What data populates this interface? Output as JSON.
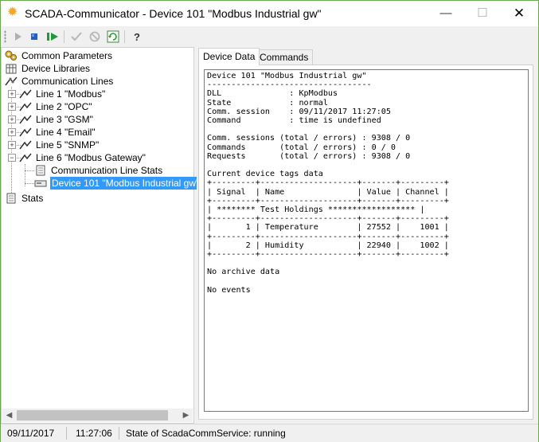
{
  "window": {
    "title": "SCADA-Communicator - Device 101 \"Modbus Industrial gw\"",
    "app_icon": "sun-icon",
    "minimize_glyph": "—",
    "maximize_glyph": "☐",
    "close_glyph": "✕"
  },
  "toolbar": {
    "buttons": [
      {
        "name": "start-icon"
      },
      {
        "name": "stop-icon"
      },
      {
        "name": "restart-icon"
      },
      {
        "name": "apply-icon"
      },
      {
        "name": "cancel-icon"
      },
      {
        "name": "refresh-icon"
      },
      {
        "name": "about-icon"
      }
    ]
  },
  "tree": {
    "common_parameters": "Common Parameters",
    "device_libraries": "Device Libraries",
    "communication_lines": "Communication Lines",
    "lines": [
      "Line 1 \"Modbus\"",
      "Line 2 \"OPC\"",
      "Line 3 \"GSM\"",
      "Line 4 \"Email\"",
      "Line 5 \"SNMP\"",
      "Line 6 \"Modbus Gateway\""
    ],
    "line6_children": [
      "Communication Line Stats",
      "Device 101 \"Modbus Industrial gw\""
    ],
    "stats": "Stats"
  },
  "tabs": {
    "device_data": "Device Data",
    "commands": "Commands"
  },
  "device_data": {
    "text": "Device 101 \"Modbus Industrial gw\"\n----------------------------------\nDLL              : KpModbus\nState            : normal\nComm. session    : 09/11/2017 11:27:05\nCommand          : time is undefined\n\nComm. sessions (total / errors) : 9308 / 0\nCommands       (total / errors) : 0 / 0\nRequests       (total / errors) : 9308 / 0\n\nCurrent device tags data\n+---------+--------------------+-------+---------+\n| Signal  | Name               | Value | Channel |\n+---------+--------------------+-------+---------+\n| ******** Test Holdings ****************** |\n+---------+--------------------+-------+---------+\n|       1 | Temperature        | 27552 |    1001 |\n+---------+--------------------+-------+---------+\n|       2 | Humidity           | 22940 |    1002 |\n+---------+--------------------+-------+---------+\n\nNo archive data\n\nNo events"
  },
  "status": {
    "date": "09/11/2017",
    "time": "11:27:06",
    "service_state": "State of ScadaCommService: running"
  }
}
